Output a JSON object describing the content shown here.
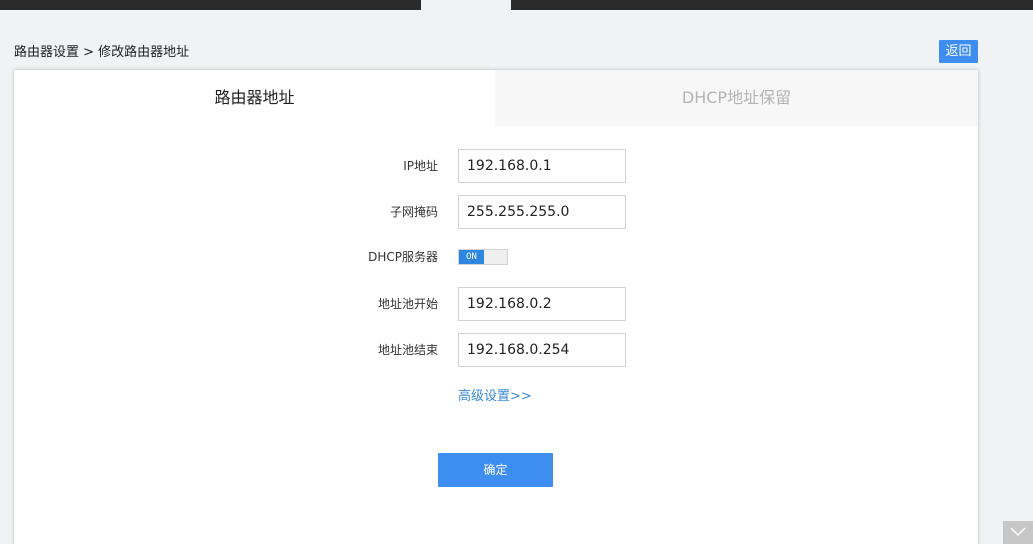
{
  "breadcrumb": "路由器设置 > 修改路由器地址",
  "back_label": "返回",
  "tabs": [
    {
      "label": "路由器地址",
      "active": true
    },
    {
      "label": "DHCP地址保留",
      "active": false
    }
  ],
  "form": {
    "ip": {
      "label": "IP地址",
      "value": "192.168.0.1"
    },
    "mask": {
      "label": "子网掩码",
      "value": "255.255.255.0"
    },
    "dhcp": {
      "label": "DHCP服务器",
      "toggle_text": "ON",
      "on": true
    },
    "pool_start": {
      "label": "地址池开始",
      "value": "192.168.0.2"
    },
    "pool_end": {
      "label": "地址池结束",
      "value": "192.168.0.254"
    }
  },
  "advanced_label": "高级设置>>",
  "confirm_label": "确定",
  "colors": {
    "accent": "#3d8ef0",
    "link": "#3a8ad8",
    "topbar": "#2b2b2b"
  },
  "icons": {
    "scroll_corner": "chevron-down-icon"
  }
}
